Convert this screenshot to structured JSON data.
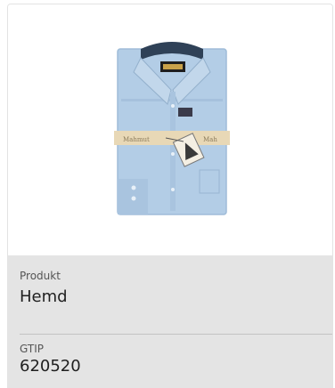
{
  "product": {
    "label": "Produkt",
    "value": "Hemd",
    "image_icon": "folded-shirt-image"
  },
  "gtip": {
    "label": "GTIP",
    "value": "620520"
  },
  "colors": {
    "shirt": "#b3cde6",
    "info_background": "#e4e4e4"
  }
}
